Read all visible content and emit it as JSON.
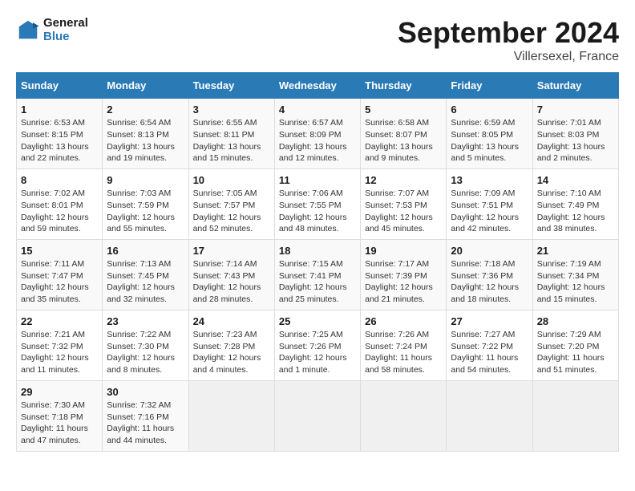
{
  "header": {
    "logo_line1": "General",
    "logo_line2": "Blue",
    "month_title": "September 2024",
    "location": "Villersexel, France"
  },
  "columns": [
    "Sunday",
    "Monday",
    "Tuesday",
    "Wednesday",
    "Thursday",
    "Friday",
    "Saturday"
  ],
  "weeks": [
    [
      {
        "day": "1",
        "sunrise": "6:53 AM",
        "sunset": "8:15 PM",
        "daylight": "13 hours and 22 minutes."
      },
      {
        "day": "2",
        "sunrise": "6:54 AM",
        "sunset": "8:13 PM",
        "daylight": "13 hours and 19 minutes."
      },
      {
        "day": "3",
        "sunrise": "6:55 AM",
        "sunset": "8:11 PM",
        "daylight": "13 hours and 15 minutes."
      },
      {
        "day": "4",
        "sunrise": "6:57 AM",
        "sunset": "8:09 PM",
        "daylight": "13 hours and 12 minutes."
      },
      {
        "day": "5",
        "sunrise": "6:58 AM",
        "sunset": "8:07 PM",
        "daylight": "13 hours and 9 minutes."
      },
      {
        "day": "6",
        "sunrise": "6:59 AM",
        "sunset": "8:05 PM",
        "daylight": "13 hours and 5 minutes."
      },
      {
        "day": "7",
        "sunrise": "7:01 AM",
        "sunset": "8:03 PM",
        "daylight": "13 hours and 2 minutes."
      }
    ],
    [
      {
        "day": "8",
        "sunrise": "7:02 AM",
        "sunset": "8:01 PM",
        "daylight": "12 hours and 59 minutes."
      },
      {
        "day": "9",
        "sunrise": "7:03 AM",
        "sunset": "7:59 PM",
        "daylight": "12 hours and 55 minutes."
      },
      {
        "day": "10",
        "sunrise": "7:05 AM",
        "sunset": "7:57 PM",
        "daylight": "12 hours and 52 minutes."
      },
      {
        "day": "11",
        "sunrise": "7:06 AM",
        "sunset": "7:55 PM",
        "daylight": "12 hours and 48 minutes."
      },
      {
        "day": "12",
        "sunrise": "7:07 AM",
        "sunset": "7:53 PM",
        "daylight": "12 hours and 45 minutes."
      },
      {
        "day": "13",
        "sunrise": "7:09 AM",
        "sunset": "7:51 PM",
        "daylight": "12 hours and 42 minutes."
      },
      {
        "day": "14",
        "sunrise": "7:10 AM",
        "sunset": "7:49 PM",
        "daylight": "12 hours and 38 minutes."
      }
    ],
    [
      {
        "day": "15",
        "sunrise": "7:11 AM",
        "sunset": "7:47 PM",
        "daylight": "12 hours and 35 minutes."
      },
      {
        "day": "16",
        "sunrise": "7:13 AM",
        "sunset": "7:45 PM",
        "daylight": "12 hours and 32 minutes."
      },
      {
        "day": "17",
        "sunrise": "7:14 AM",
        "sunset": "7:43 PM",
        "daylight": "12 hours and 28 minutes."
      },
      {
        "day": "18",
        "sunrise": "7:15 AM",
        "sunset": "7:41 PM",
        "daylight": "12 hours and 25 minutes."
      },
      {
        "day": "19",
        "sunrise": "7:17 AM",
        "sunset": "7:39 PM",
        "daylight": "12 hours and 21 minutes."
      },
      {
        "day": "20",
        "sunrise": "7:18 AM",
        "sunset": "7:36 PM",
        "daylight": "12 hours and 18 minutes."
      },
      {
        "day": "21",
        "sunrise": "7:19 AM",
        "sunset": "7:34 PM",
        "daylight": "12 hours and 15 minutes."
      }
    ],
    [
      {
        "day": "22",
        "sunrise": "7:21 AM",
        "sunset": "7:32 PM",
        "daylight": "12 hours and 11 minutes."
      },
      {
        "day": "23",
        "sunrise": "7:22 AM",
        "sunset": "7:30 PM",
        "daylight": "12 hours and 8 minutes."
      },
      {
        "day": "24",
        "sunrise": "7:23 AM",
        "sunset": "7:28 PM",
        "daylight": "12 hours and 4 minutes."
      },
      {
        "day": "25",
        "sunrise": "7:25 AM",
        "sunset": "7:26 PM",
        "daylight": "12 hours and 1 minute."
      },
      {
        "day": "26",
        "sunrise": "7:26 AM",
        "sunset": "7:24 PM",
        "daylight": "11 hours and 58 minutes."
      },
      {
        "day": "27",
        "sunrise": "7:27 AM",
        "sunset": "7:22 PM",
        "daylight": "11 hours and 54 minutes."
      },
      {
        "day": "28",
        "sunrise": "7:29 AM",
        "sunset": "7:20 PM",
        "daylight": "11 hours and 51 minutes."
      }
    ],
    [
      {
        "day": "29",
        "sunrise": "7:30 AM",
        "sunset": "7:18 PM",
        "daylight": "11 hours and 47 minutes."
      },
      {
        "day": "30",
        "sunrise": "7:32 AM",
        "sunset": "7:16 PM",
        "daylight": "11 hours and 44 minutes."
      },
      null,
      null,
      null,
      null,
      null
    ]
  ]
}
